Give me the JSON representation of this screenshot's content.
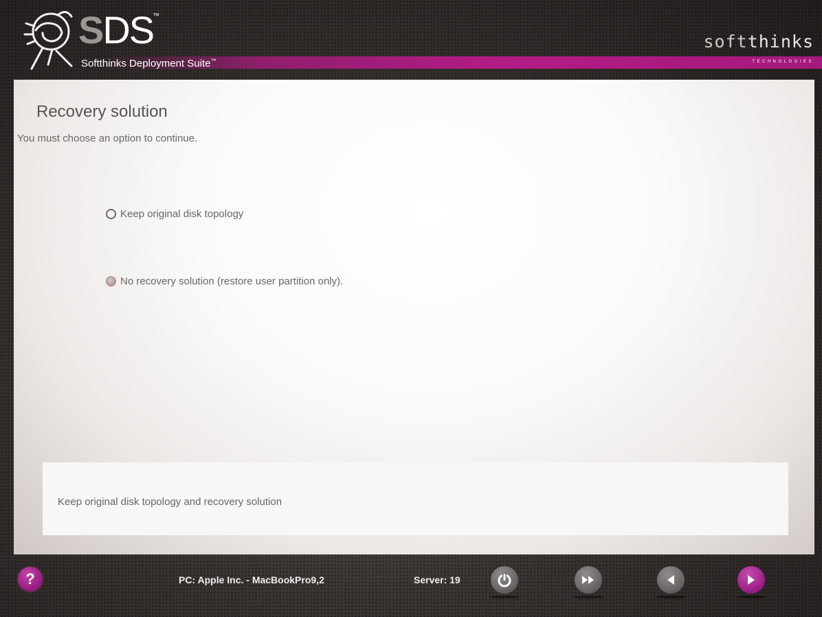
{
  "header": {
    "product_wordmark_s": "S",
    "product_wordmark_rest": "DS",
    "trademark": "™",
    "suite_name": "Softthinks Deployment Suite",
    "suite_tm": "™",
    "brand_logo_part1": "soft",
    "brand_logo_part2": "thinks",
    "brand_sub": "TECHNOLOGIES",
    "accent_color": "#b31c86"
  },
  "main": {
    "title": "Recovery solution",
    "subtitle": "You must choose an option to continue.",
    "options": [
      {
        "label": "Keep original disk topology",
        "selected": false
      },
      {
        "label": "No recovery solution (restore user partition only).",
        "selected": false
      }
    ],
    "description": "Keep original disk topology and recovery solution"
  },
  "footer": {
    "help_label": "?",
    "pc_info": "PC: Apple Inc. - MacBookPro9,2",
    "server_info": "Server: 19",
    "buttons": [
      {
        "name": "shutdown",
        "icon": "power-icon"
      },
      {
        "name": "skip",
        "icon": "fast-forward-icon"
      },
      {
        "name": "back",
        "icon": "back-arrow-icon"
      },
      {
        "name": "next",
        "icon": "next-arrow-icon"
      }
    ]
  }
}
